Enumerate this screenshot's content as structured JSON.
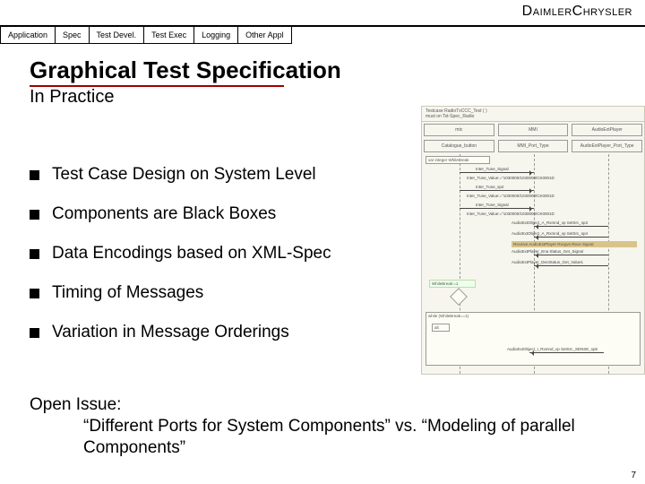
{
  "brand": "DaimlerChrysler",
  "tabs": [
    "Application",
    "Spec",
    "Test Devel.",
    "Test Exec",
    "Logging",
    "Other Appl"
  ],
  "title": "Graphical Test Specification",
  "subtitle": "In Practice",
  "bullets": [
    "Test Case Design on System Level",
    "Components are Black Boxes",
    "Data Encodings based on XML-Spec",
    "Timing of Messages",
    "Variation in Message Orderings"
  ],
  "open_issue": {
    "label": "Open Issue:",
    "text": "“Different Ports for System Components” vs. “Modeling of parallel Components”"
  },
  "page_number": "7",
  "diagram": {
    "header1": "Testcase RadioTxCCC_Test  ( )",
    "header2": "must on  Tst-Spec_Radio",
    "cols": [
      "mtc",
      "MMI",
      "AudioExtPlayer"
    ],
    "col_sub": [
      "Catalogue_button",
      "MMI_Port_Type",
      "AudioExtPlayer_Port_Type"
    ],
    "var": "var integer WhileBreak",
    "msgs": [
      "Inter_Tune_Signal",
      "Inter_Tune_Value:=\"1030000/1030000/CK0001D",
      "Inter_Tune_sp2",
      "Inter_Tune_Value:=\"1030000/1030000/CK0001D",
      "Inter_Tune_Signal",
      "Inter_Tune_Value:=\"1030000/1030000/CK0001D",
      "AudioExtObject_A_Rxmnd_vp SetSrc_sp3",
      "AudioExtObject_A_Rxmnd_vp SetSrc_sp4",
      "Receive AudioExtPlayer Rxcgvs Rece Signal",
      "AudioExtPlayer_Ena Status_Get_Signal",
      "AudioExtPlayer_DecStatus_Get_Value1"
    ],
    "block1": "WhileBreak:=1",
    "while_label": "while (WhileBreak==1)",
    "alt_label": "alt",
    "bottom_msg": "AudioExtObject_I_Rxmnd_vp SetSrc_SENSE_sp6"
  }
}
